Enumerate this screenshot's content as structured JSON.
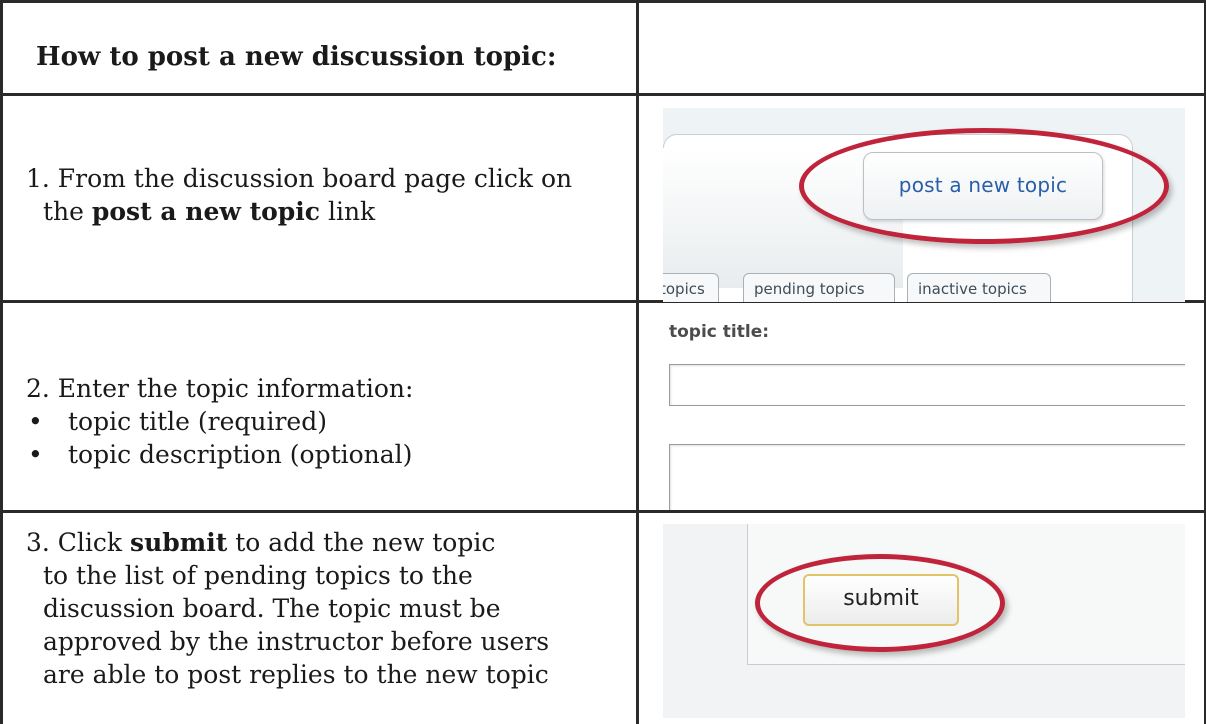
{
  "heading": "How to post a new discussion topic:",
  "step1": {
    "line1": "1. From the discussion board page click on",
    "line2_before": "the ",
    "line2_bold": "post a new topic",
    "line2_after": " link"
  },
  "step2": {
    "intro": "2. Enter the topic information:",
    "bullet_symbol": "•",
    "bullets": [
      "topic title (required)",
      "topic description (optional)"
    ]
  },
  "step3": {
    "line1_before": "3. Click ",
    "line1_bold": "submit",
    "line1_after": " to add the new topic",
    "line2": "to the list of pending topics to the",
    "line3": "discussion board. The topic must be",
    "line4": "approved by the instructor before users",
    "line5": "are able to post replies to the new topic"
  },
  "screenshot1": {
    "button_label": "post a new topic",
    "tabs": [
      "topics",
      "pending topics",
      "inactive topics"
    ],
    "highlight_color": "#c0243a"
  },
  "screenshot2": {
    "field_label": "topic title:"
  },
  "screenshot3": {
    "button_label": "submit",
    "highlight_color": "#c0243a"
  }
}
